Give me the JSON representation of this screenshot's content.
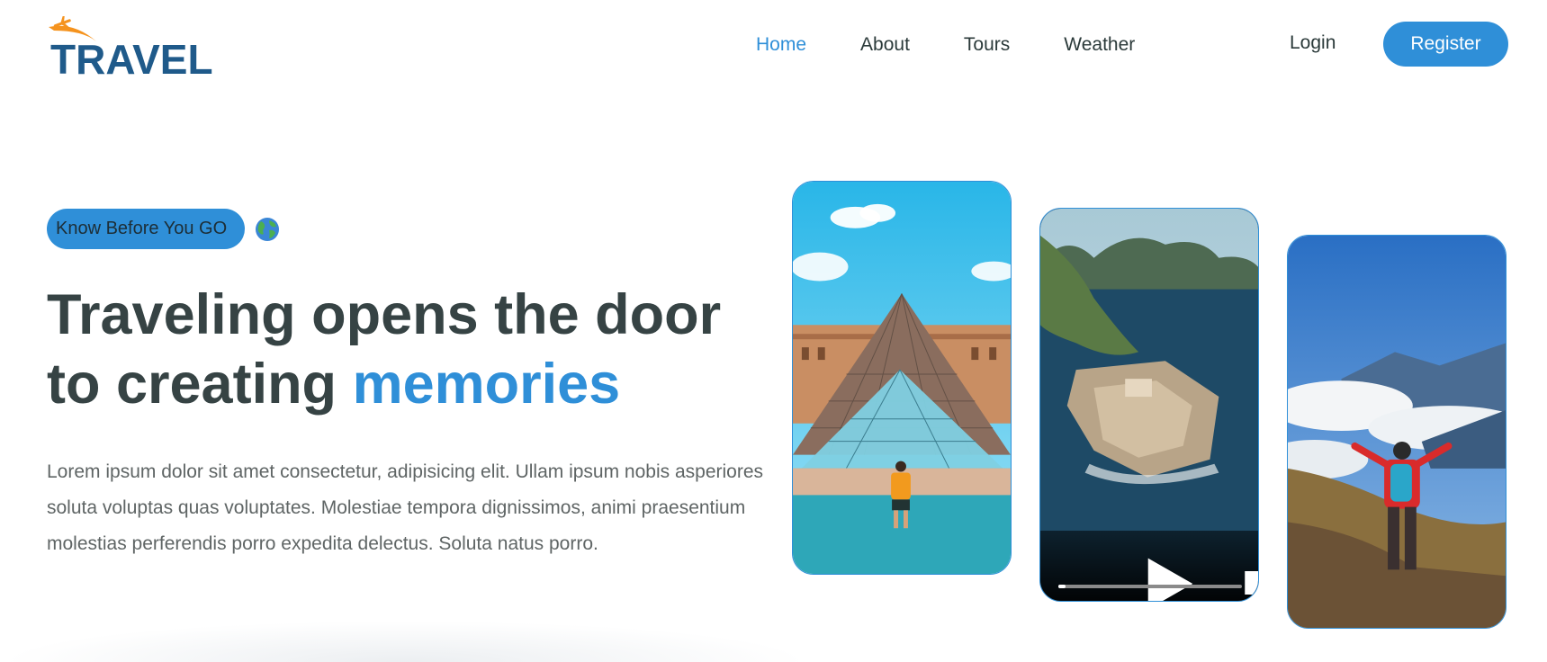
{
  "brand": {
    "name": "TRAVEL",
    "accent": "#2f8fd8",
    "orange": "#f5931e",
    "navy": "#1f5a8a"
  },
  "nav": {
    "links": [
      {
        "label": "Home",
        "active": true
      },
      {
        "label": "About",
        "active": false
      },
      {
        "label": "Tours",
        "active": false
      },
      {
        "label": "Weather",
        "active": false
      }
    ],
    "login_label": "Login",
    "register_label": "Register"
  },
  "hero": {
    "badge_label": "Know Before You GO",
    "badge_icon": "globe-icon",
    "headline_line1": "Traveling opens the door",
    "headline_line2_prefix": "to creating ",
    "headline_accent": "memories",
    "description": "Lorem ipsum dolor sit amet consectetur, adipisicing elit. Ullam ipsum nobis asperiores soluta voluptas quas voluptates. Molestiae tempora dignissimos, animi praesentium molestias perferendis porro expedita delectus. Soluta natus porro."
  },
  "gallery": {
    "video": {
      "progress": 0.04,
      "icons": [
        "play-icon",
        "volume-icon",
        "more-options-icon"
      ]
    }
  }
}
